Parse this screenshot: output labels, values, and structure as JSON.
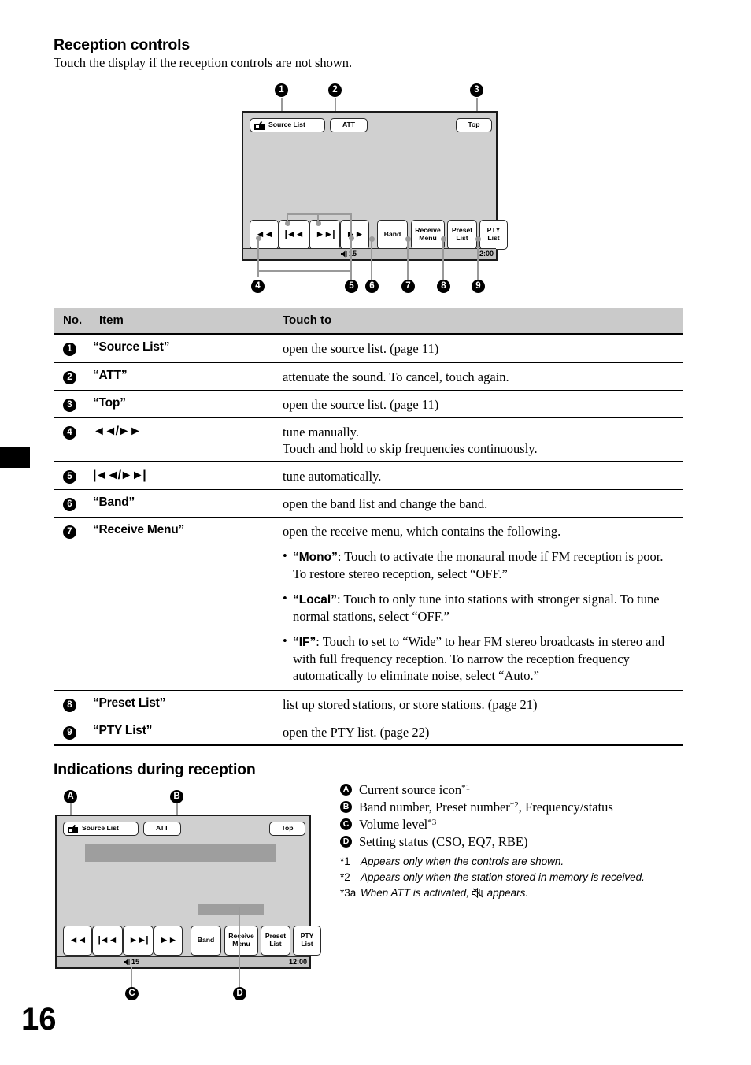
{
  "page": {
    "number": "16"
  },
  "section1": {
    "heading": "Reception controls",
    "intro": "Touch the display if the reception controls are not shown."
  },
  "diagram1": {
    "callouts": [
      "1",
      "2",
      "3",
      "4",
      "5",
      "6",
      "7",
      "8",
      "9"
    ],
    "buttons": {
      "source_list": "Source List",
      "att": "ATT",
      "top": "Top",
      "seek_back": "◄◄",
      "track_back": "|◄◄",
      "track_fwd": "►►|",
      "seek_fwd": "►►",
      "band": "Band",
      "receive_menu": "Receive\nMenu",
      "preset_list": "Preset\nList",
      "pty_list": "PTY\nList"
    },
    "status": {
      "volume": "15",
      "clock": "2:00"
    }
  },
  "table": {
    "headers": {
      "no": "No.",
      "item": "Item",
      "touch_to": "Touch to"
    },
    "rows": [
      {
        "no": "1",
        "item": "“Source List”",
        "touch_to": "open the source list. (page 11)"
      },
      {
        "no": "2",
        "item": "“ATT”",
        "touch_to": "attenuate the sound. To cancel, touch again."
      },
      {
        "no": "3",
        "item": "“Top”",
        "touch_to": "open the source list. (page 11)"
      },
      {
        "no": "4",
        "item": "◄◄/►►",
        "touch_to_l1": "tune manually.",
        "touch_to_l2": "Touch and hold to skip frequencies continuously."
      },
      {
        "no": "5",
        "item": "|◄◄/►►|",
        "touch_to": "tune automatically."
      },
      {
        "no": "6",
        "item": "“Band”",
        "touch_to": "open the band list and change the band."
      },
      {
        "no": "7",
        "item": "“Receive Menu”",
        "touch_to": "open the receive menu, which contains the following.",
        "bullets": [
          {
            "term": "“Mono”",
            "rest": ": Touch to activate the monaural mode if FM reception is poor. To restore stereo reception, select “OFF.”"
          },
          {
            "term": "“Local”",
            "rest": ": Touch to only tune into stations with stronger signal. To tune normal stations, select “OFF.”"
          },
          {
            "term": "“IF”",
            "rest": ": Touch to set to “Wide” to hear FM stereo broadcasts in stereo and with full frequency reception. To narrow the reception frequency automatically to eliminate noise, select “Auto.”"
          }
        ]
      },
      {
        "no": "8",
        "item": "“Preset List”",
        "touch_to": "list up stored stations, or store stations. (page 21)"
      },
      {
        "no": "9",
        "item": "“PTY List”",
        "touch_to": "open the PTY list. (page 22)"
      }
    ]
  },
  "section2": {
    "heading": "Indications during reception"
  },
  "diagram2": {
    "callouts": [
      "A",
      "B",
      "C",
      "D"
    ],
    "buttons": {
      "source_list": "Source List",
      "att": "ATT",
      "top": "Top",
      "seek_back": "◄◄",
      "track_back": "|◄◄",
      "track_fwd": "►►|",
      "seek_fwd": "►►",
      "band": "Band",
      "receive_menu": "Receive\nMenu",
      "preset_list": "Preset\nList",
      "pty_list": "PTY\nList"
    },
    "status": {
      "volume": "15",
      "clock": "12:00"
    }
  },
  "legend": {
    "items": [
      {
        "key": "A",
        "text": "Current source icon",
        "fn": "*1"
      },
      {
        "key": "B",
        "text": "Band number, Preset number",
        "fn": "*2",
        "text_after": ", Frequency/status"
      },
      {
        "key": "C",
        "text": "Volume level",
        "fn": "*3"
      },
      {
        "key": "D",
        "text": "Setting status (CSO, EQ7, RBE)",
        "fn": ""
      }
    ],
    "footnotes": [
      {
        "mark": "*1",
        "text": "Appears only when the controls are shown."
      },
      {
        "mark": "*2",
        "text": "Appears only when the station stored in memory is received."
      },
      {
        "mark": "*3a",
        "text": "When ATT is activated,",
        "text_b": "appears."
      }
    ]
  }
}
